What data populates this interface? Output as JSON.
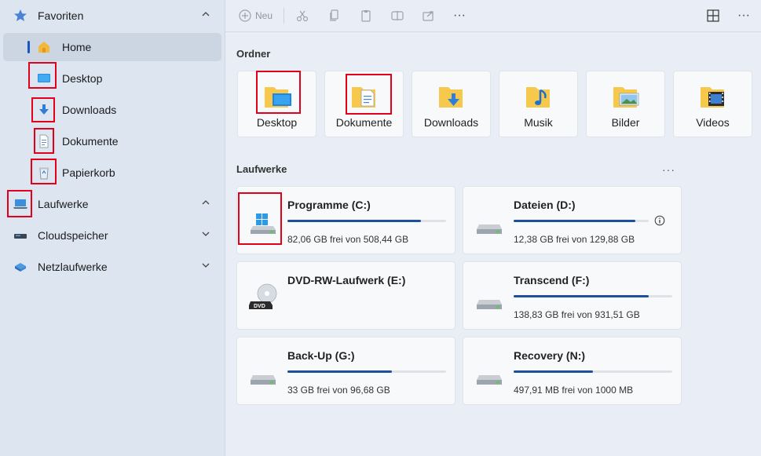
{
  "sidebar": {
    "favorites": {
      "label": "Favoriten",
      "icon": "star-icon"
    },
    "items": [
      {
        "label": "Home",
        "icon": "home-icon"
      },
      {
        "label": "Desktop",
        "icon": "desktop-icon"
      },
      {
        "label": "Downloads",
        "icon": "download-icon"
      },
      {
        "label": "Dokumente",
        "icon": "document-icon"
      },
      {
        "label": "Papierkorb",
        "icon": "recycle-bin-icon"
      }
    ],
    "drives": {
      "label": "Laufwerke",
      "icon": "laptop-icon"
    },
    "cloud": {
      "label": "Cloudspeicher",
      "icon": "cloud-icon"
    },
    "network": {
      "label": "Netzlaufwerke",
      "icon": "network-icon"
    }
  },
  "toolbar": {
    "new_label": "Neu",
    "more": "···"
  },
  "main": {
    "folders_title": "Ordner",
    "folders": [
      {
        "label": "Desktop",
        "icon": "desktop-folder-icon"
      },
      {
        "label": "Dokumente",
        "icon": "documents-folder-icon"
      },
      {
        "label": "Downloads",
        "icon": "downloads-folder-icon"
      },
      {
        "label": "Musik",
        "icon": "music-folder-icon"
      },
      {
        "label": "Bilder",
        "icon": "pictures-folder-icon"
      },
      {
        "label": "Videos",
        "icon": "videos-folder-icon"
      }
    ],
    "drives_title": "Laufwerke",
    "drives_more": "···",
    "drives": [
      {
        "name": "Programme (C:)",
        "free": "82,06 GB frei von 508,44 GB",
        "used_fraction": 0.84,
        "icon": "windows-drive-icon"
      },
      {
        "name": "Dateien (D:)",
        "free": "12,38 GB frei von 129,88 GB",
        "used_fraction": 0.9,
        "icon": "hard-drive-icon",
        "info": true
      },
      {
        "name": "DVD-RW-Laufwerk (E:)",
        "free": "",
        "used_fraction": null,
        "icon": "dvd-drive-icon"
      },
      {
        "name": "Transcend (F:)",
        "free": "138,83 GB frei von 931,51 GB",
        "used_fraction": 0.85,
        "icon": "hard-drive-icon"
      },
      {
        "name": "Back-Up (G:)",
        "free": "33 GB frei von 96,68 GB",
        "used_fraction": 0.66,
        "icon": "hard-drive-icon"
      },
      {
        "name": "Recovery (N:)",
        "free": "497,91 MB frei von 1000 MB",
        "used_fraction": 0.5,
        "icon": "hard-drive-icon"
      }
    ]
  },
  "colors": {
    "accent": "#1a56c2",
    "bar": "#1c4f9c",
    "highlight": "#e3001a",
    "folder": "#f6c84c"
  }
}
